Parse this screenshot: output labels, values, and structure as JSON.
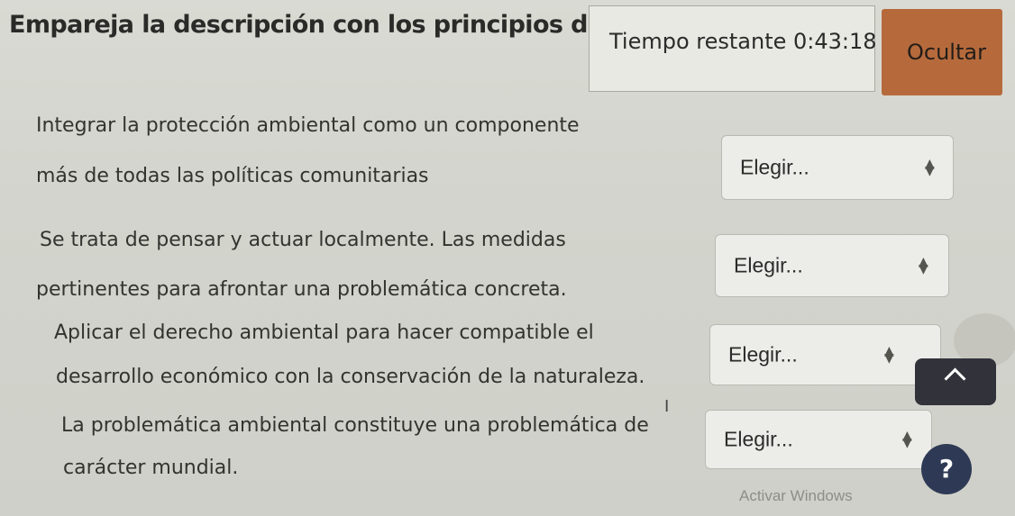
{
  "header": {
    "title": "Empareja la descripción con los principios del de",
    "timer_text": "Tiempo restante 0:43:18",
    "hide_label": "Ocultar"
  },
  "items": [
    {
      "line1": "Integrar la protección ambiental como un componente",
      "line2": "más de todas las políticas comunitarias",
      "select": "Elegir..."
    },
    {
      "line1": "Se trata de pensar y actuar localmente. Las medidas",
      "line2": "pertinentes para afrontar una problemática concreta.",
      "select": "Elegir..."
    },
    {
      "line1": "Aplicar el derecho ambiental para hacer compatible el",
      "line2": "desarrollo económico con la conservación de la naturaleza.",
      "select": "Elegir..."
    },
    {
      "line1": "La problemática ambiental constituye una problemática de",
      "line2": "carácter mundial.",
      "select": "Elegir..."
    }
  ],
  "icons": {
    "up": "chevron-up-icon",
    "help": "question-icon",
    "arrows": "updown-arrows-icon"
  },
  "watermark": "Activar Windows",
  "help_label": "?",
  "colors": {
    "hide_button": "#b66a3c",
    "up_button": "#31323a",
    "help_button": "#2e3a55"
  }
}
